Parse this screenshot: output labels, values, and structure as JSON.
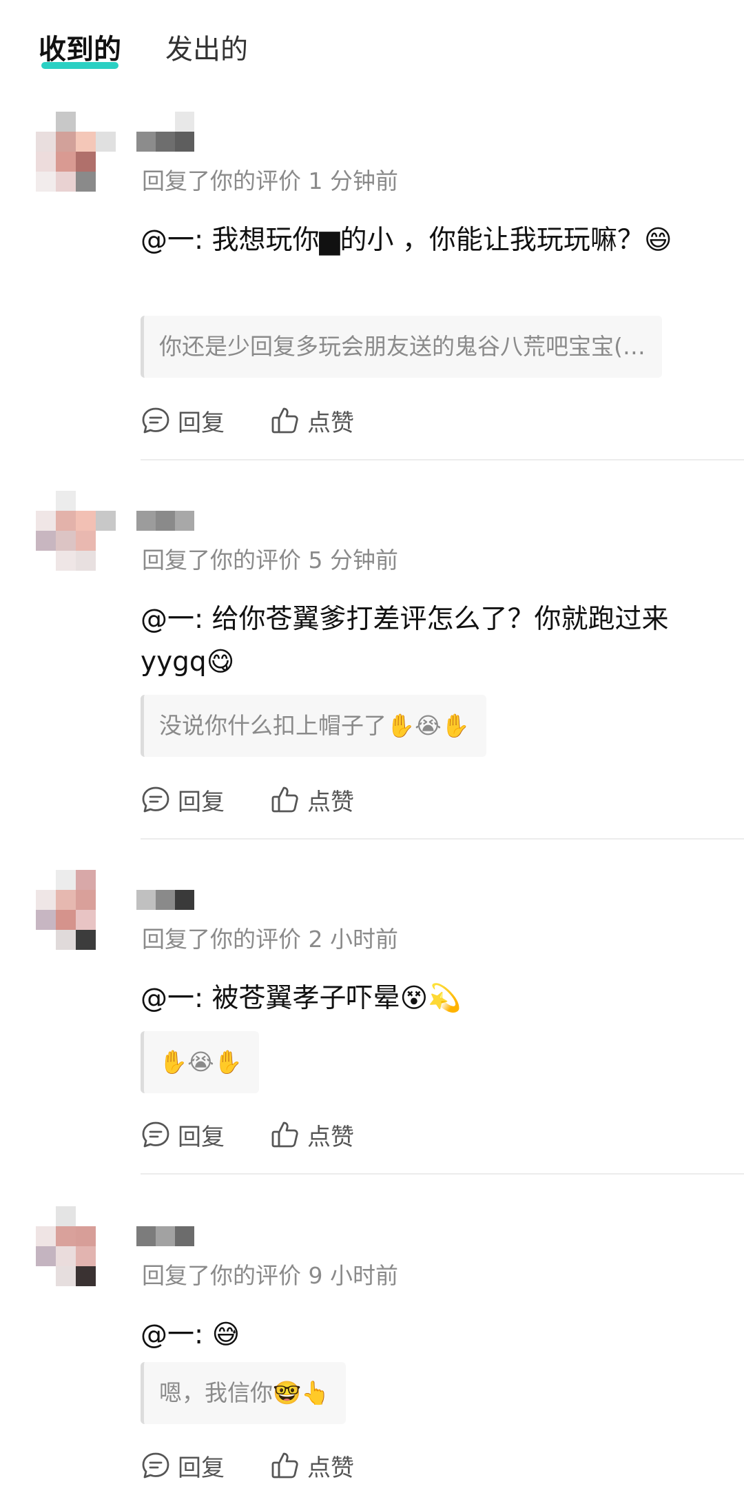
{
  "tabs": {
    "received": "收到的",
    "sent": "发出的"
  },
  "notifications": [
    {
      "meta": "回复了你的评价 1 分钟前",
      "content": "@一: 我想玩你▆的小 ，你能让我玩玩嘛？😄",
      "quote": "你还是少回复多玩会朋友送的鬼谷八荒吧宝宝(…",
      "reply_label": "回复",
      "like_label": "点赞"
    },
    {
      "meta": "回复了你的评价 5 分钟前",
      "content": "@一: 给你苍翼爹打差评怎么了？你就跑过来yygq😋",
      "quote": "没说你什么扣上帽子了✋😭✋",
      "reply_label": "回复",
      "like_label": "点赞"
    },
    {
      "meta": "回复了你的评价 2 小时前",
      "content": "@一: 被苍翼孝子吓晕😵💫",
      "quote": "✋😭✋",
      "reply_label": "回复",
      "like_label": "点赞"
    },
    {
      "meta": "回复了你的评价 9 小时前",
      "content": "@一: 😅",
      "quote": "嗯，我信你🤓👆",
      "reply_label": "回复",
      "like_label": "点赞"
    }
  ],
  "icons": {
    "reply": "comment-bubble-icon",
    "like": "thumbs-up-icon"
  },
  "colors": {
    "accent": "#2bd0c3",
    "meta_text": "#8a8a8a",
    "quote_bg": "#f7f7f7"
  }
}
